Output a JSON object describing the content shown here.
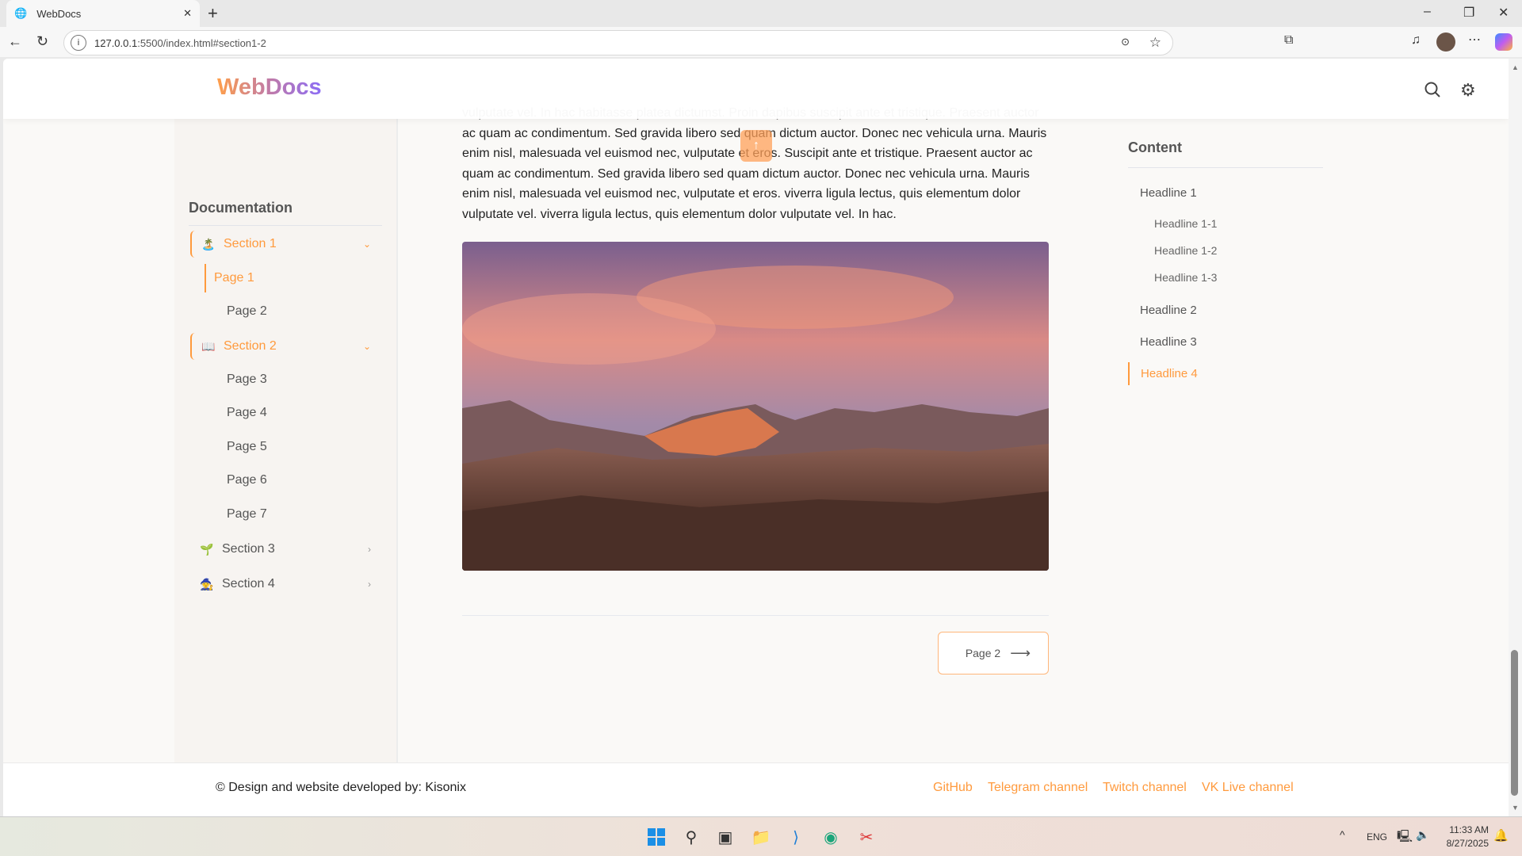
{
  "browser": {
    "tab_title": "WebDocs",
    "url_host": "127.0.0.1",
    "url_rest": ":5500/index.html#section1-2"
  },
  "header": {
    "logo": "WebDocs"
  },
  "sidebar": {
    "title": "Documentation",
    "sections": [
      {
        "label": "Section 1",
        "emoji": "🏝️",
        "pages": [
          "Page 1",
          "Page 2"
        ]
      },
      {
        "label": "Section 2",
        "emoji": "📖",
        "pages": [
          "Page 3",
          "Page 4",
          "Page 5",
          "Page 6",
          "Page 7"
        ]
      },
      {
        "label": "Section 3",
        "emoji": "🌱"
      },
      {
        "label": "Section 4",
        "emoji": "🧙"
      }
    ]
  },
  "main": {
    "partial_line": "vulputate vel. In hac habitasse platea dictumst. Proin dapibus suscipit ante et tristique. Praesent auctor",
    "paragraph": "ac quam ac condimentum. Sed gravida libero sed quam dictum auctor. Donec nec vehicula urna. Mauris enim nisl, malesuada vel euismod nec, vulputate et eros. Suscipit ante et tristique. Praesent auctor ac quam ac condimentum. Sed gravida libero sed quam dictum auctor. Donec nec vehicula urna. Mauris enim nisl, malesuada vel euismod nec, vulputate et eros. viverra ligula lectus, quis elementum dolor vulputate vel. viverra ligula lectus, quis elementum dolor vulputate vel. In hac.",
    "next_button": "Page 2",
    "scroll_top": "↑"
  },
  "toc": {
    "title": "Content",
    "items": [
      "Headline 1",
      "Headline 1-1",
      "Headline 1-2",
      "Headline 1-3",
      "Headline 2",
      "Headline 3",
      "Headline 4"
    ]
  },
  "footer": {
    "copyright": "© Design and website developed by: Kisonix",
    "links": [
      "GitHub",
      "Telegram channel",
      "Twitch channel",
      "VK Live channel"
    ]
  },
  "taskbar": {
    "lang": "ENG",
    "time": "11:33 AM",
    "date": "8/27/2025"
  },
  "colors": {
    "accent": "#ff9a3d",
    "background": "#faf9f7"
  }
}
